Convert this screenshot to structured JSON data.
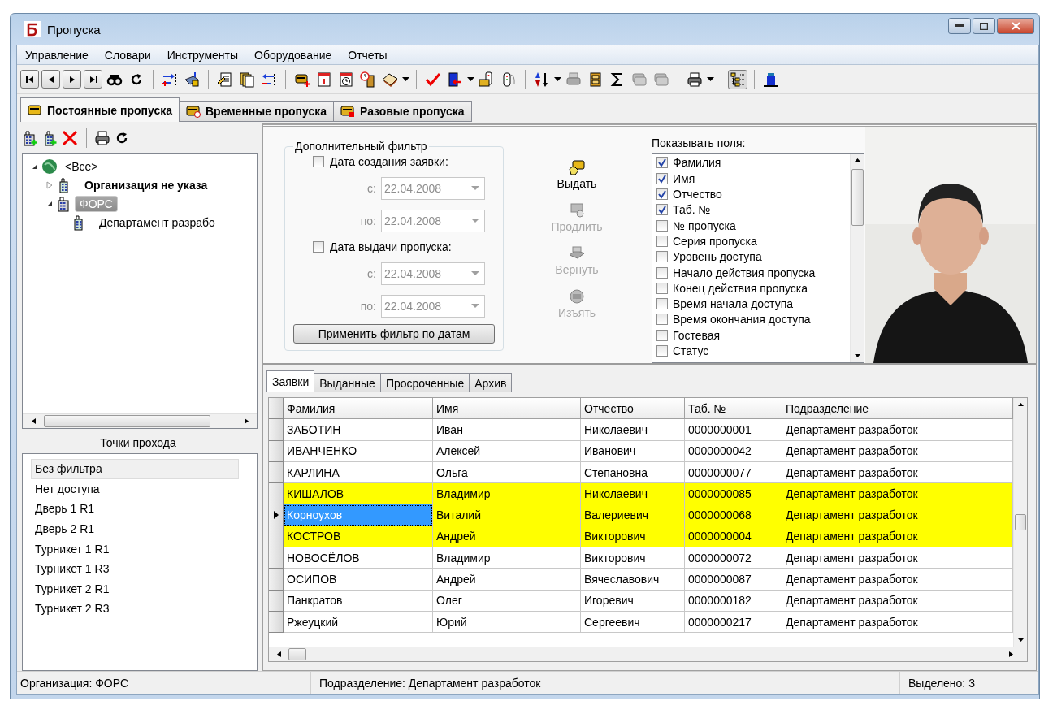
{
  "window": {
    "title": "Пропуска"
  },
  "menu": [
    "Управление",
    "Словари",
    "Инструменты",
    "Оборудование",
    "Отчеты"
  ],
  "main_tabs": [
    {
      "label": "Постоянные пропуска",
      "selected": true
    },
    {
      "label": "Временные пропуска",
      "selected": false
    },
    {
      "label": "Разовые пропуска",
      "selected": false
    }
  ],
  "tree": [
    {
      "label": "<Все>",
      "bold": false,
      "expanded": true,
      "selected": false,
      "children": [
        {
          "label": "Организация не указа",
          "bold": true,
          "expanded": false,
          "selected": false
        },
        {
          "label": "ФОРС",
          "bold": false,
          "expanded": true,
          "selected": true,
          "children": [
            {
              "label": "Департамент разрабо",
              "bold": false,
              "selected": false
            }
          ]
        }
      ]
    }
  ],
  "access_points": {
    "title": "Точки прохода",
    "items": [
      {
        "label": "Без фильтра",
        "selected": true
      },
      {
        "label": "Нет доступа",
        "selected": false
      },
      {
        "label": "Дверь 1 R1",
        "selected": false
      },
      {
        "label": "Дверь 2 R1",
        "selected": false
      },
      {
        "label": "Турникет 1 R1",
        "selected": false
      },
      {
        "label": "Турникет 1 R3",
        "selected": false
      },
      {
        "label": "Турникет 2 R1",
        "selected": false
      },
      {
        "label": "Турникет 2 R3",
        "selected": false
      }
    ]
  },
  "filter": {
    "title": "Дополнительный фильтр",
    "groups": [
      {
        "label": "Дата создания заявки:",
        "checked": false,
        "from": {
          "label": "с:",
          "value": "22.04.2008",
          "disabled": true
        },
        "to": {
          "label": "по:",
          "value": "22.04.2008",
          "disabled": true
        }
      },
      {
        "label": "Дата выдачи пропуска:",
        "checked": false,
        "from": {
          "label": "с:",
          "value": "22.04.2008",
          "disabled": true
        },
        "to": {
          "label": "по:",
          "value": "22.04.2008",
          "disabled": true
        }
      }
    ],
    "apply_button": "Применить фильтр по датам"
  },
  "actions": [
    {
      "label": "Выдать",
      "disabled": false
    },
    {
      "label": "Продлить",
      "disabled": true
    },
    {
      "label": "Вернуть",
      "disabled": true
    },
    {
      "label": "Изъять",
      "disabled": true
    }
  ],
  "fields": {
    "title": "Показывать поля:",
    "items": [
      {
        "label": "Фамилия",
        "checked": true
      },
      {
        "label": "Имя",
        "checked": true
      },
      {
        "label": "Отчество",
        "checked": true
      },
      {
        "label": "Таб. №",
        "checked": true
      },
      {
        "label": "№ пропуска",
        "checked": false
      },
      {
        "label": "Серия пропуска",
        "checked": false
      },
      {
        "label": "Уровень доступа",
        "checked": false
      },
      {
        "label": "Начало действия пропуска",
        "checked": false
      },
      {
        "label": "Конец действия пропуска",
        "checked": false
      },
      {
        "label": "Время начала доступа",
        "checked": false
      },
      {
        "label": "Время окончания доступа",
        "checked": false
      },
      {
        "label": "Гостевая",
        "checked": false
      },
      {
        "label": "Статус",
        "checked": false
      }
    ]
  },
  "photo": {
    "kind": "picture"
  },
  "sub_tabs": [
    {
      "label": "Заявки",
      "selected": true
    },
    {
      "label": "Выданные",
      "selected": false
    },
    {
      "label": "Просроченные",
      "selected": false
    },
    {
      "label": "Архив",
      "selected": false
    }
  ],
  "table": {
    "columns": [
      "Фамилия",
      "Имя",
      "Отчество",
      "Таб. №",
      "Подразделение"
    ],
    "rows": [
      {
        "cells": [
          "ЗАБОТИН",
          "Иван",
          "Николаевич",
          "0000000001",
          "Департамент разработок"
        ],
        "highlighted": false,
        "selected": false
      },
      {
        "cells": [
          "ИВАНЧЕНКО",
          "Алексей",
          "Иванович",
          "0000000042",
          "Департамент разработок"
        ],
        "highlighted": false,
        "selected": false
      },
      {
        "cells": [
          "КАРЛИНА",
          "Ольга",
          "Степановна",
          "0000000077",
          "Департамент разработок"
        ],
        "highlighted": false,
        "selected": false
      },
      {
        "cells": [
          "КИШАЛОВ",
          "Владимир",
          "Николаевич",
          "0000000085",
          "Департамент разработок"
        ],
        "highlighted": true,
        "selected": false
      },
      {
        "cells": [
          "Корноухов",
          "Виталий",
          "Валериевич",
          "0000000068",
          "Департамент разработок"
        ],
        "highlighted": true,
        "selected": true
      },
      {
        "cells": [
          "КОСТРОВ",
          "Андрей",
          "Викторович",
          "0000000004",
          "Департамент разработок"
        ],
        "highlighted": true,
        "selected": false
      },
      {
        "cells": [
          "НОВОСЁЛОВ",
          "Владимир",
          "Викторович",
          "0000000072",
          "Департамент разработок"
        ],
        "highlighted": false,
        "selected": false
      },
      {
        "cells": [
          "ОСИПОВ",
          "Андрей",
          "Вячеславович",
          "0000000087",
          "Департамент разработок"
        ],
        "highlighted": false,
        "selected": false
      },
      {
        "cells": [
          "Панкратов",
          "Олег",
          "Игоревич",
          "0000000182",
          "Департамент разработок"
        ],
        "highlighted": false,
        "selected": false
      },
      {
        "cells": [
          "Ржеуцкий",
          "Юрий",
          "Сергеевич",
          "0000000217",
          "Департамент разработок"
        ],
        "highlighted": false,
        "selected": false
      }
    ]
  },
  "status_bar": [
    "Организация: ФОРС",
    "Подразделение: Департамент разработок",
    "Выделено: 3"
  ]
}
